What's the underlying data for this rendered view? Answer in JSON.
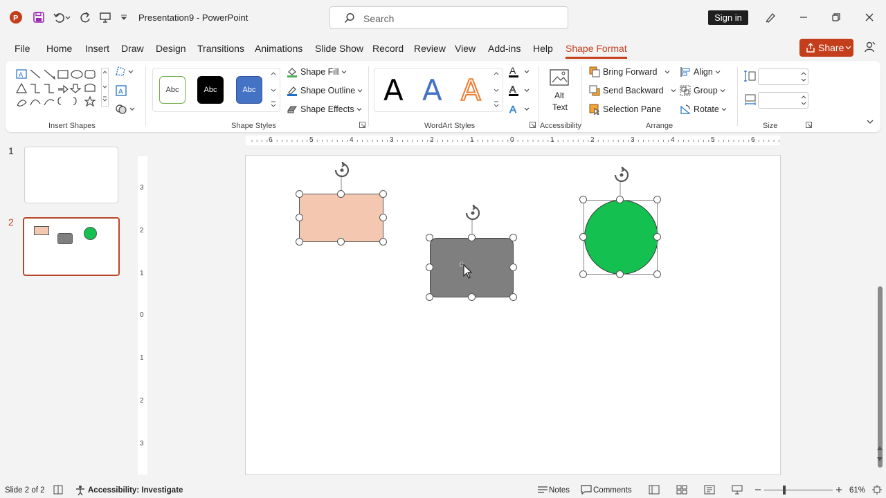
{
  "app": {
    "document_title": "Presentation9",
    "app_name": "PowerPoint",
    "title_separator": "-",
    "search_placeholder": "Search",
    "signin_label": "Sign in",
    "share_label": "Share",
    "accent_color": "#c43e1c"
  },
  "tabs": [
    {
      "label": "File"
    },
    {
      "label": "Home"
    },
    {
      "label": "Insert"
    },
    {
      "label": "Draw"
    },
    {
      "label": "Design"
    },
    {
      "label": "Transitions"
    },
    {
      "label": "Animations"
    },
    {
      "label": "Slide Show"
    },
    {
      "label": "Record"
    },
    {
      "label": "Review"
    },
    {
      "label": "View"
    },
    {
      "label": "Add-ins"
    },
    {
      "label": "Help"
    },
    {
      "label": "Shape Format",
      "active": true
    }
  ],
  "ribbon": {
    "insert_shapes": {
      "label": "Insert Shapes"
    },
    "shape_styles": {
      "label": "Shape Styles",
      "thumb_label": "Abc",
      "fill": "Shape Fill",
      "outline": "Shape Outline",
      "effects": "Shape Effects"
    },
    "wordart": {
      "label": "WordArt Styles",
      "letter": "A"
    },
    "accessibility": {
      "label": "Accessibility",
      "alt_text_line1": "Alt",
      "alt_text_line2": "Text"
    },
    "arrange": {
      "label": "Arrange",
      "bring_forward": "Bring Forward",
      "send_backward": "Send Backward",
      "selection_pane": "Selection Pane",
      "align": "Align",
      "group": "Group",
      "rotate": "Rotate"
    },
    "size": {
      "label": "Size",
      "height": "",
      "width": ""
    }
  },
  "slides_panel": [
    {
      "number": "1"
    },
    {
      "number": "2",
      "selected": true
    }
  ],
  "rulers": {
    "horizontal": [
      "6",
      "5",
      "4",
      "3",
      "2",
      "1",
      "0",
      "1",
      "2",
      "3",
      "4",
      "5",
      "6"
    ],
    "vertical": [
      "3",
      "2",
      "1",
      "0",
      "1",
      "2",
      "3"
    ]
  },
  "slide": {
    "shapes": [
      {
        "type": "rectangle",
        "fill": "#f4c7b0",
        "selected": true
      },
      {
        "type": "rounded-rectangle",
        "fill": "#7f7f7f",
        "selected": true
      },
      {
        "type": "circle",
        "fill": "#14c150",
        "selected": true
      }
    ]
  },
  "statusbar": {
    "slide_indicator": "Slide 2 of 2",
    "accessibility": "Accessibility: Investigate",
    "notes": "Notes",
    "comments": "Comments",
    "zoom": "61%"
  }
}
